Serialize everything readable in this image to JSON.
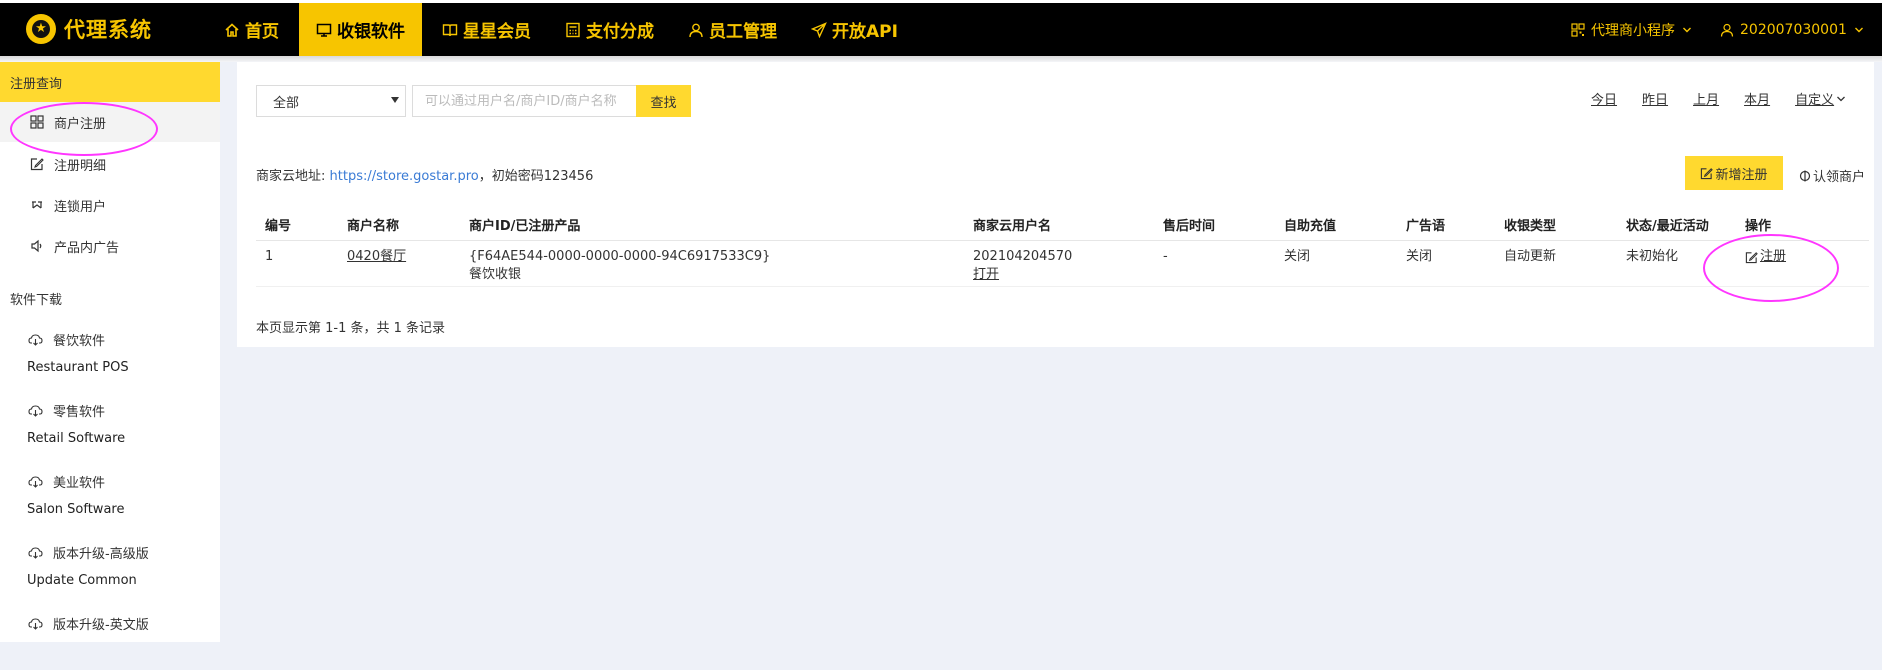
{
  "app": {
    "title": "代理系统",
    "logo_icon": "star-badge-icon",
    "brand_color": "#f7c500"
  },
  "nav": {
    "items": [
      {
        "label": "首页",
        "icon": "home-icon"
      },
      {
        "label": "收银软件",
        "icon": "monitor-icon",
        "active": true
      },
      {
        "label": "星星会员",
        "icon": "book-icon"
      },
      {
        "label": "支付分成",
        "icon": "calculator-icon"
      },
      {
        "label": "员工管理",
        "icon": "user-icon"
      },
      {
        "label": "开放API",
        "icon": "send-icon"
      }
    ],
    "mini_program": "代理商小程序",
    "account": "202007030001"
  },
  "sidebar": {
    "section_register": "注册查询",
    "items": [
      {
        "label": "商户注册",
        "icon": "grid-icon",
        "active": true
      },
      {
        "label": "注册明细",
        "icon": "edit-icon"
      },
      {
        "label": "连锁用户",
        "icon": "chain-icon"
      },
      {
        "label": "产品内广告",
        "icon": "speaker-icon"
      }
    ],
    "section_download": "软件下载",
    "downloads": [
      {
        "label": "餐饮软件",
        "subtitle": "Restaurant POS"
      },
      {
        "label": "零售软件",
        "subtitle": "Retail Software"
      },
      {
        "label": "美业软件",
        "subtitle": "Salon Software"
      },
      {
        "label": "版本升级-高级版",
        "subtitle": "Update Common"
      },
      {
        "label": "版本升级-英文版",
        "subtitle": ""
      }
    ]
  },
  "filter": {
    "select_value": "全部",
    "search_placeholder": "可以通过用户名/商户ID/商户名称",
    "search_button": "查找",
    "date_links": [
      "今日",
      "昨日",
      "上月",
      "本月"
    ],
    "custom_label": "自定义"
  },
  "store": {
    "prefix": "商家云地址: ",
    "url": "https://store.gostar.pro",
    "suffix": "，初始密码123456"
  },
  "actions": {
    "new_register": "新增注册",
    "claim_merchant": "认领商户"
  },
  "table": {
    "columns": [
      "编号",
      "商户名称",
      "商户ID/已注册产品",
      "商家云用户名",
      "售后时间",
      "自助充值",
      "广告语",
      "收银类型",
      "状态/最近活动",
      "操作"
    ],
    "rows": [
      {
        "no": "1",
        "name": "0420餐厅",
        "merchant_id": "{F64AE544-0000-0000-0000-94C6917533C9}",
        "product": "餐饮收银",
        "cloud_user": "202104204570",
        "cloud_open": "打开",
        "after_sale": "-",
        "self_recharge": "关闭",
        "slogan": "关闭",
        "pos_type": "自动更新",
        "status": "未初始化",
        "op": "注册"
      }
    ]
  },
  "pagination": {
    "summary": "本页显示第 1-1 条，共 1 条记录"
  }
}
